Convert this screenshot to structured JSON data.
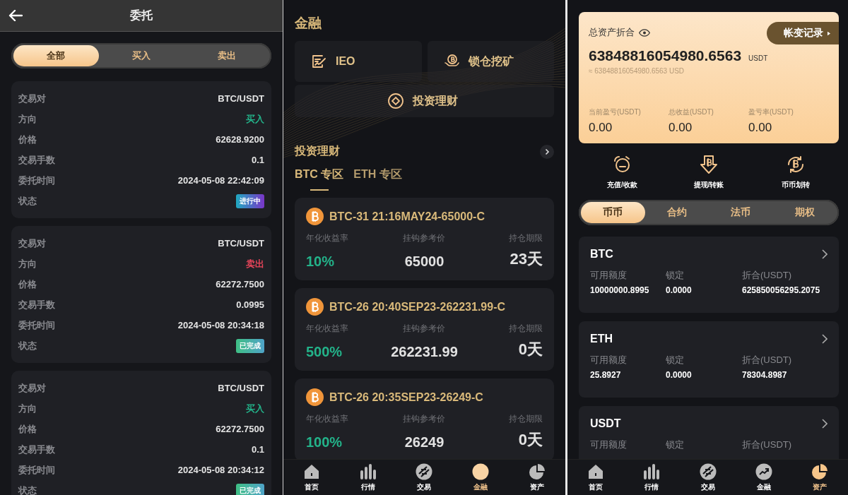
{
  "orders_screen": {
    "title": "委托",
    "tabs": [
      {
        "label": "全部",
        "selected": true
      },
      {
        "label": "买入",
        "selected": false
      },
      {
        "label": "卖出",
        "selected": false
      }
    ],
    "orders": [
      {
        "rows": [
          {
            "label": "交易对",
            "value": "BTC/USDT",
            "kind": "text"
          },
          {
            "label": "方向",
            "value": "买入",
            "kind": "buy"
          },
          {
            "label": "价格",
            "value": "62628.9200",
            "kind": "text"
          },
          {
            "label": "交易手数",
            "value": "0.1",
            "kind": "text"
          },
          {
            "label": "委托时间",
            "value": "2024-05-08 22:42:09",
            "kind": "text"
          },
          {
            "label": "状态",
            "value": "进行中",
            "kind": "active"
          }
        ]
      },
      {
        "rows": [
          {
            "label": "交易对",
            "value": "BTC/USDT",
            "kind": "text"
          },
          {
            "label": "方向",
            "value": "卖出",
            "kind": "sell"
          },
          {
            "label": "价格",
            "value": "62272.7500",
            "kind": "text"
          },
          {
            "label": "交易手数",
            "value": "0.0995",
            "kind": "text"
          },
          {
            "label": "委托时间",
            "value": "2024-05-08 20:34:18",
            "kind": "text"
          },
          {
            "label": "状态",
            "value": "已完成",
            "kind": "done"
          }
        ]
      },
      {
        "rows": [
          {
            "label": "交易对",
            "value": "BTC/USDT",
            "kind": "text"
          },
          {
            "label": "方向",
            "value": "买入",
            "kind": "buy"
          },
          {
            "label": "价格",
            "value": "62272.7500",
            "kind": "text"
          },
          {
            "label": "交易手数",
            "value": "0.1",
            "kind": "text"
          },
          {
            "label": "委托时间",
            "value": "2024-05-08 20:34:12",
            "kind": "text"
          },
          {
            "label": "状态",
            "value": "已完成",
            "kind": "done"
          }
        ]
      }
    ]
  },
  "finance_screen": {
    "title": "金融",
    "menu": [
      {
        "label": "IEO",
        "kind": "ieo"
      },
      {
        "label": "锁仓挖矿",
        "kind": "mining"
      },
      {
        "label": "投资理财",
        "kind": "invest"
      }
    ],
    "section_title": "投资理财",
    "zone_tabs": [
      {
        "label": "BTC 专区",
        "selected": true
      },
      {
        "label": "ETH 专区",
        "selected": false
      }
    ],
    "products": [
      {
        "name": "BTC-31 21:16MAY24-65000-C",
        "rate_label": "年化收益率",
        "rate": "10%",
        "price_label": "挂钩参考价",
        "price": "65000",
        "term_label": "持仓期限",
        "term": "23天"
      },
      {
        "name": "BTC-26 20:40SEP23-262231.99-C",
        "rate_label": "年化收益率",
        "rate": "500%",
        "price_label": "挂钩参考价",
        "price": "262231.99",
        "term_label": "持仓期限",
        "term": "0天"
      },
      {
        "name": "BTC-26 20:35SEP23-26249-C",
        "rate_label": "年化收益率",
        "rate": "100%",
        "price_label": "挂钩参考价",
        "price": "26249",
        "term_label": "持仓期限",
        "term": "0天"
      }
    ],
    "nav": [
      {
        "label": "首页",
        "kind": "home",
        "selected": false
      },
      {
        "label": "行情",
        "kind": "market",
        "selected": false
      },
      {
        "label": "交易",
        "kind": "trade",
        "selected": false
      },
      {
        "label": "金融",
        "kind": "finance",
        "selected": true
      },
      {
        "label": "资产",
        "kind": "assets",
        "selected": false
      }
    ]
  },
  "assets_screen": {
    "total_label": "总资产折合",
    "history_button": "帐变记录",
    "total": "63848816054980.6563",
    "unit": "USDT",
    "approx": "≈ 63848816054980.6563 USD",
    "stats": [
      {
        "label": "当前盈亏(USDT)",
        "value": "0.00"
      },
      {
        "label": "总收益(USDT)",
        "value": "0.00"
      },
      {
        "label": "盈亏率(USDT)",
        "value": "0.00"
      }
    ],
    "actions": [
      {
        "label": "充值/收款",
        "kind": "deposit"
      },
      {
        "label": "提现/转账",
        "kind": "withdraw"
      },
      {
        "label": "币币划转",
        "kind": "transfer"
      }
    ],
    "tabs": [
      {
        "label": "币币",
        "selected": true
      },
      {
        "label": "合约",
        "selected": false
      },
      {
        "label": "法币",
        "selected": false
      },
      {
        "label": "期权",
        "selected": false
      }
    ],
    "coins": [
      {
        "name": "BTC",
        "columns": [
          {
            "label": "可用额度",
            "value": "10000000.8995"
          },
          {
            "label": "锁定",
            "value": "0.0000"
          },
          {
            "label": "折合(USDT)",
            "value": "625850056295.2075"
          }
        ]
      },
      {
        "name": "ETH",
        "columns": [
          {
            "label": "可用额度",
            "value": "25.8927"
          },
          {
            "label": "锁定",
            "value": "0.0000"
          },
          {
            "label": "折合(USDT)",
            "value": "78304.8987"
          }
        ]
      },
      {
        "name": "USDT",
        "columns": [
          {
            "label": "可用额度"
          },
          {
            "label": "锁定"
          },
          {
            "label": "折合(USDT)"
          }
        ]
      }
    ],
    "nav": [
      {
        "label": "首页",
        "kind": "home",
        "selected": false
      },
      {
        "label": "行情",
        "kind": "market",
        "selected": false
      },
      {
        "label": "交易",
        "kind": "trade",
        "selected": false
      },
      {
        "label": "金融",
        "kind": "finance",
        "selected": false
      },
      {
        "label": "资产",
        "kind": "assets",
        "selected": true
      }
    ]
  }
}
